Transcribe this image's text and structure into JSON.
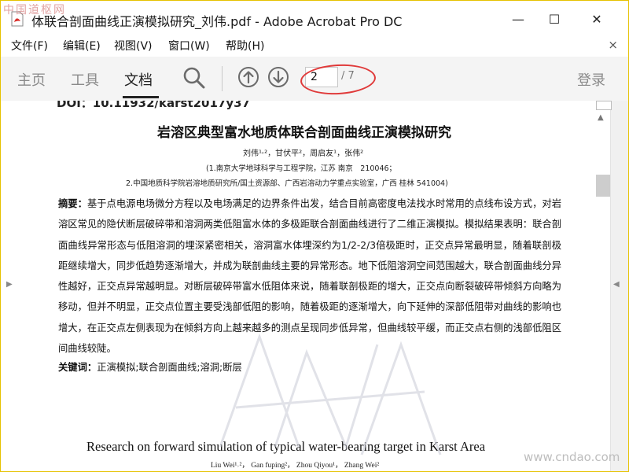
{
  "window": {
    "title": "体联合剖面曲线正演模拟研究_刘伟.pdf - Adobe Acrobat Pro DC",
    "controls": {
      "minimize": "—",
      "maximize": "☐",
      "close": "✕"
    }
  },
  "watermark": {
    "top": "中国道枢网",
    "bottom": "www.cndao.com"
  },
  "menu": {
    "items": [
      "文件(F)",
      "编辑(E)",
      "视图(V)",
      "窗口(W)",
      "帮助(H)"
    ],
    "close": "×"
  },
  "toolbar": {
    "tabs": {
      "home": "主页",
      "tools": "工具",
      "document": "文档"
    },
    "page_current": "2",
    "page_total": "/ 7",
    "login": "登录",
    "icons": [
      "search-icon",
      "arrow-up-circle-icon",
      "arrow-down-circle-icon"
    ]
  },
  "document": {
    "doi": "DOI：10.11932/karst2017y37",
    "title": "岩溶区典型富水地质体联合剖面曲线正演模拟研究",
    "authors": "刘伟¹˒²，甘伏平²，周启友¹，张伟²",
    "affiliation_1": "(1.南京大学地球科学与工程学院，江苏 南京　210046；",
    "affiliation_2": "2.中国地质科学院岩溶地质研究所/国土资源部、广西岩溶动力学重点实验室，广西 桂林 541004)",
    "abstract_label": "摘要：",
    "abstract_text": "基于点电源电场微分方程以及电场满足的边界条件出发，结合目前高密度电法找水时常用的点线布设方式，对岩溶区常见的隐伏断层破碎带和溶洞两类低阻富水体的多极距联合剖面曲线进行了二维正演模拟。模拟结果表明：联合剖面曲线异常形态与低阻溶洞的埋深紧密相关，溶洞富水体埋深约为1/2-2/3倍极距时，正交点异常最明显，随着联剖极距继续增大，同步低趋势逐渐增大，并成为联剖曲线主要的异常形态。地下低阻溶洞空间范围越大，联合剖面曲线分异性越好，正交点异常越明显。对断层破碎带富水低阻体来说，随着联剖极距的增大，正交点向断裂破碎带倾斜方向略为移动，但并不明显，正交点位置主要受浅部低阻的影响，随着极距的逐渐增大，向下延伸的深部低阻带对曲线的影响也增大，在正交点左侧表现为在倾斜方向上越来越多的测点呈现同步低异常，但曲线较平缓，而正交点右侧的浅部低阻区间曲线较陡。",
    "keywords_label": "关键词：",
    "keywords_text": "正演模拟;联合剖面曲线;溶洞;断层",
    "en_title": "Research on forward simulation of typical water-bearing target in Karst Area",
    "en_authors": "Liu Wei¹˒²， Gan fuping²， Zhou Qiyou¹， Zhang Wei²"
  },
  "colors": {
    "annotation": "#e03a3a",
    "toolbar_bg": "#f4f4f4",
    "window_border": "#e6c200"
  }
}
